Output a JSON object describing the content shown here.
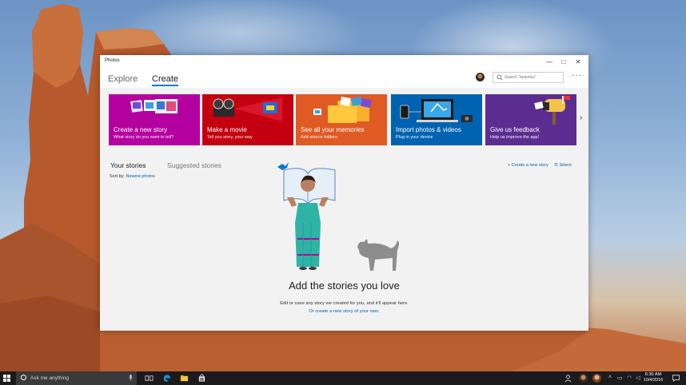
{
  "window": {
    "app_title": "Photos",
    "minimize": "—",
    "maximize": "□",
    "close": "✕"
  },
  "nav": {
    "tabs": [
      {
        "label": "Explore",
        "active": false
      },
      {
        "label": "Create",
        "active": true
      }
    ],
    "search_placeholder": "Search \"beaches\"",
    "more": "···"
  },
  "tiles": [
    {
      "title": "Create a new story",
      "subtitle": "What story do you want to tell?",
      "color": "#b4009e"
    },
    {
      "title": "Make a movie",
      "subtitle": "Tell you story, your way",
      "color": "#c40010"
    },
    {
      "title": "See all your memories",
      "subtitle": "Add source folders",
      "color": "#e05a24"
    },
    {
      "title": "Import photos & videos",
      "subtitle": "Plug in your device",
      "color": "#0063b1"
    },
    {
      "title": "Give us feedback",
      "subtitle": "Help us improve the app!",
      "color": "#5c2d91"
    }
  ],
  "tiles_next": "›",
  "stories": {
    "tabs": [
      {
        "label": "Your stories",
        "active": true
      },
      {
        "label": "Suggested stories",
        "active": false
      }
    ],
    "sort_label": "Sort by:",
    "sort_value": "Newest photos",
    "create_new": "Create a new story",
    "select": "Select",
    "empty_title": "Add the stories you love",
    "empty_subtitle": "Edit or save any story we created for you, and it'll appear here.",
    "empty_link": "Or create a new story of your own."
  },
  "taskbar": {
    "search_placeholder": "Ask me anything",
    "time": "6:30 AM",
    "date": "10/4/2016"
  },
  "colors": {
    "accent": "#0078d7",
    "link": "#0063b1"
  }
}
